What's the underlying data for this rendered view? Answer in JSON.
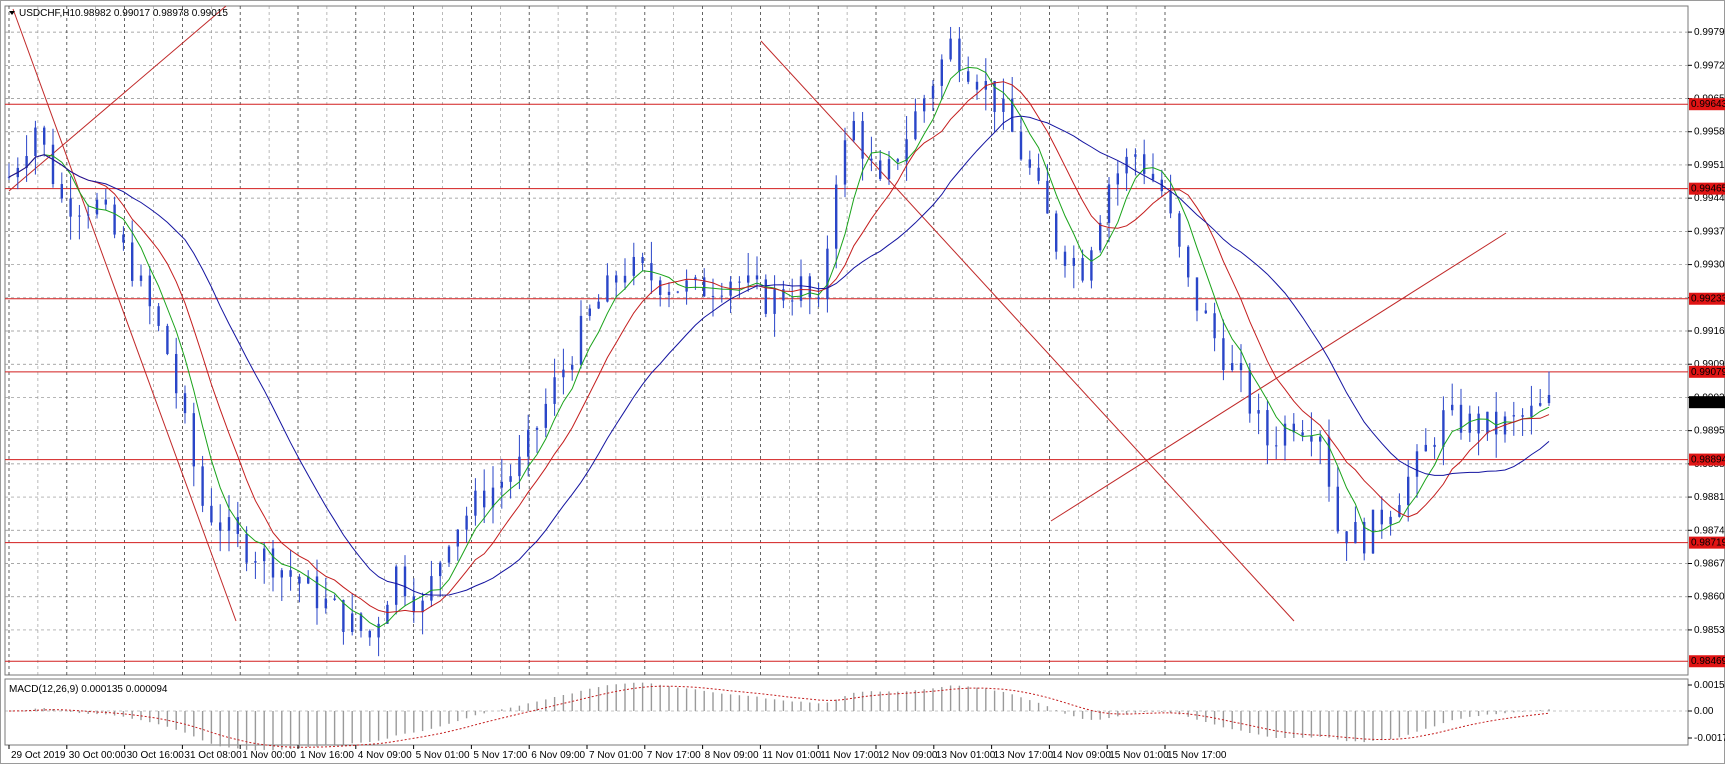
{
  "chart_title": {
    "symbol": "USDCHF,H1",
    "ohlc": "0.98982 0.99017 0.98978 0.99015"
  },
  "macd_label": "MACD(12,26,9) 0.000135 0.000094",
  "colors": {
    "candles": "#2a46c8",
    "ma_fast": "#1aa31a",
    "ma_mid": "#c41e1e",
    "ma_slow": "#1414a0",
    "level_lines": "#d21e1e",
    "trend_lines": "#c02828",
    "grid": "#8c8c8c",
    "price_tag_red": "#e01414",
    "price_tag_current": "#000000",
    "macd_hist": "#9a9a9a",
    "macd_signal": "#c41e1e"
  },
  "chart_data": {
    "type": "candlestick",
    "price_axis": {
      "range": [
        0.9844,
        0.9985
      ],
      "ticks": [
        "0.99795",
        "0.99725",
        "0.99655",
        "0.99585",
        "0.99515",
        "0.99445",
        "0.99375",
        "0.99305",
        "0.99235",
        "0.99165",
        "0.99095",
        "0.99025",
        "0.98955",
        "0.98885",
        "0.98815",
        "0.98745",
        "0.98675",
        "0.98605",
        "0.98535"
      ]
    },
    "time_axis": {
      "labels": [
        "29 Oct 2019",
        "30 Oct 00:00",
        "30 Oct 16:00",
        "31 Oct 08:00",
        "1 Nov 00:00",
        "1 Nov 16:00",
        "4 Nov 09:00",
        "5 Nov 01:00",
        "5 Nov 17:00",
        "6 Nov 09:00",
        "7 Nov 01:00",
        "7 Nov 17:00",
        "8 Nov 09:00",
        "11 Nov 01:00",
        "11 Nov 17:00",
        "12 Nov 09:00",
        "13 Nov 01:00",
        "13 Nov 17:00",
        "14 Nov 09:00",
        "15 Nov 01:00",
        "15 Nov 17:00"
      ]
    },
    "horizontal_levels": [
      {
        "label": "0.99643",
        "price": 0.99643
      },
      {
        "label": "0.99465",
        "price": 0.99465
      },
      {
        "label": "0.99233",
        "price": 0.99233
      },
      {
        "label": "0.99079",
        "price": 0.99079
      },
      {
        "label": "0.98894",
        "price": 0.98894
      },
      {
        "label": "0.98719",
        "price": 0.98719
      },
      {
        "label": "0.98469",
        "price": 0.98469
      }
    ],
    "current_price": {
      "label": "0.99015",
      "price": 0.99015
    },
    "price_path": [
      [
        0,
        0.9949
      ],
      [
        3,
        0.996
      ],
      [
        6,
        0.9944
      ],
      [
        10,
        0.9943
      ],
      [
        14,
        0.993
      ],
      [
        18,
        0.9912
      ],
      [
        22,
        0.988
      ],
      [
        26,
        0.9872
      ],
      [
        30,
        0.9868
      ],
      [
        34,
        0.9862
      ],
      [
        38,
        0.9856
      ],
      [
        41,
        0.9852
      ],
      [
        44,
        0.9866
      ],
      [
        47,
        0.9858
      ],
      [
        50,
        0.9874
      ],
      [
        54,
        0.9882
      ],
      [
        58,
        0.9888
      ],
      [
        62,
        0.9905
      ],
      [
        66,
        0.992
      ],
      [
        70,
        0.993
      ],
      [
        74,
        0.9927
      ],
      [
        78,
        0.9925
      ],
      [
        82,
        0.9928
      ],
      [
        86,
        0.9923
      ],
      [
        90,
        0.9926
      ],
      [
        92,
        0.992
      ],
      [
        94,
        0.995
      ],
      [
        96,
        0.996
      ],
      [
        99,
        0.9946
      ],
      [
        103,
        0.9962
      ],
      [
        107,
        0.9977
      ],
      [
        111,
        0.9968
      ],
      [
        113,
        0.9962
      ],
      [
        116,
        0.995
      ],
      [
        119,
        0.9935
      ],
      [
        122,
        0.993
      ],
      [
        125,
        0.9948
      ],
      [
        128,
        0.9954
      ],
      [
        131,
        0.9946
      ],
      [
        134,
        0.9926
      ],
      [
        137,
        0.9915
      ],
      [
        140,
        0.9905
      ],
      [
        143,
        0.9893
      ],
      [
        146,
        0.9898
      ],
      [
        149,
        0.9896
      ],
      [
        151,
        0.9875
      ],
      [
        154,
        0.9873
      ],
      [
        157,
        0.988
      ],
      [
        160,
        0.9888
      ],
      [
        163,
        0.9898
      ],
      [
        166,
        0.9897
      ],
      [
        169,
        0.9896
      ],
      [
        172,
        0.9898
      ],
      [
        175,
        0.9901
      ]
    ],
    "macd": {
      "value": 0.000135,
      "signal": 9.4e-05,
      "axis_ticks": [
        "0.00154",
        "0.00",
        "-0.00179"
      ]
    }
  }
}
